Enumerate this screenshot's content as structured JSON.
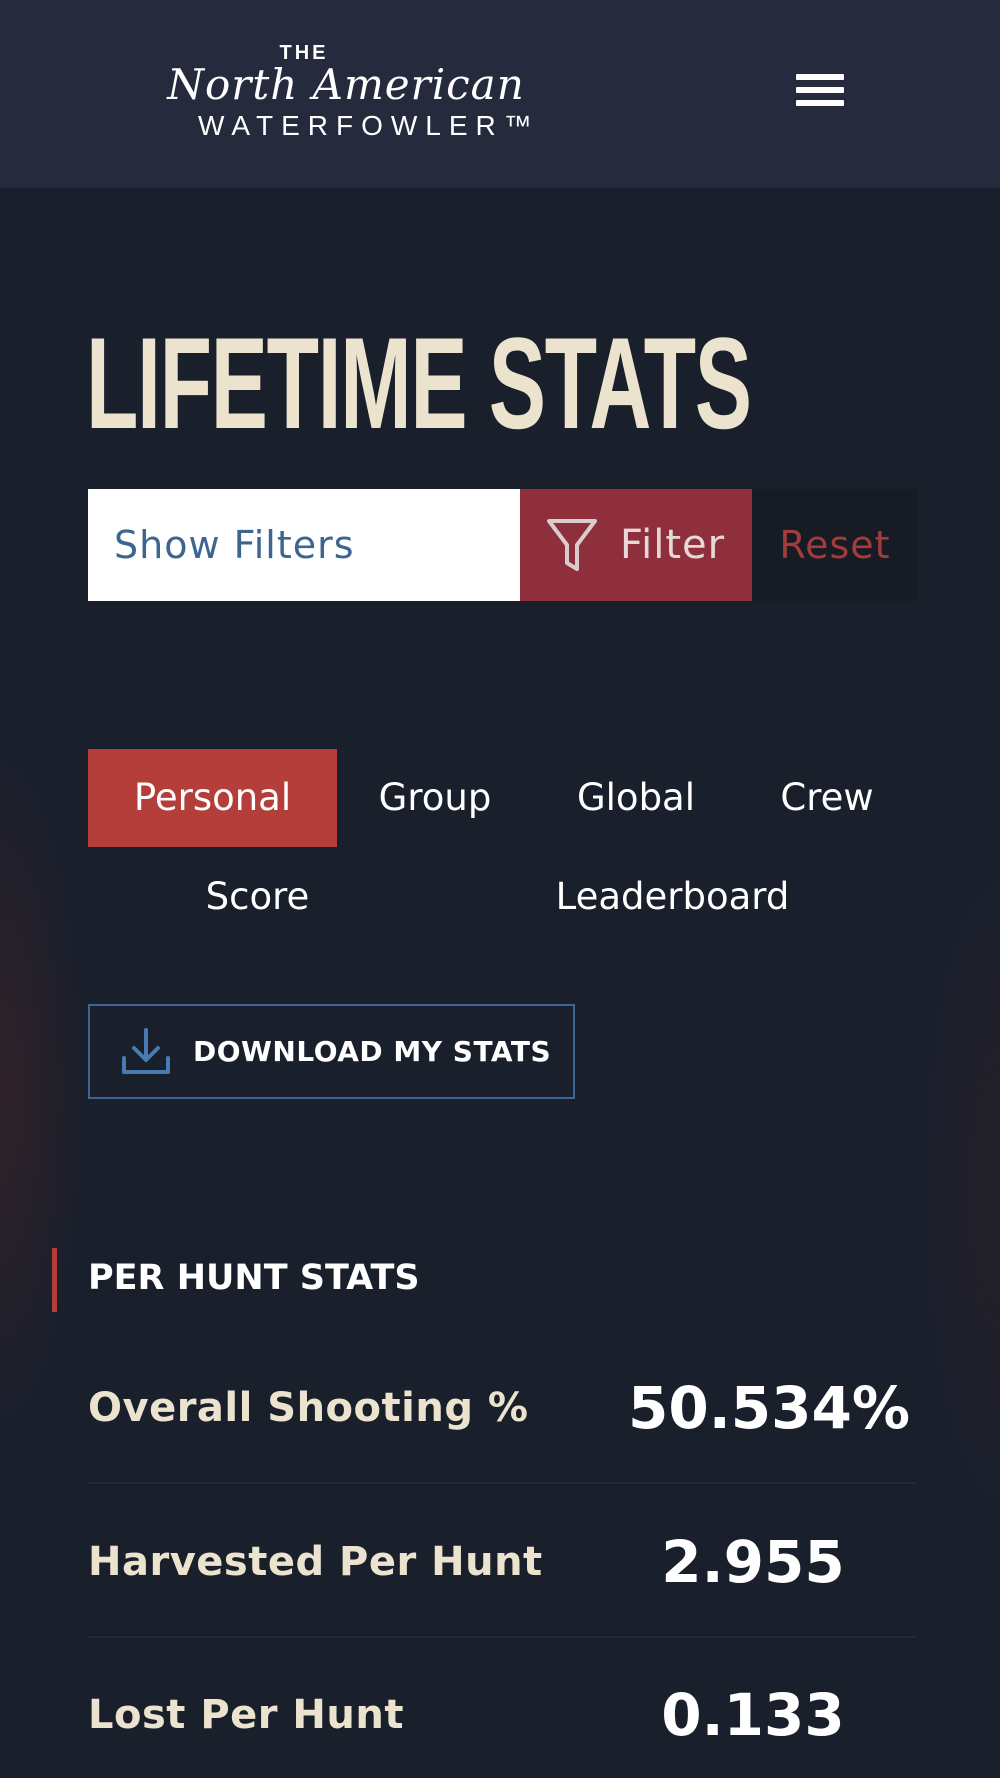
{
  "header": {
    "logo": {
      "the": "THE",
      "main": "North American",
      "sub": "WATERFOWLER™"
    },
    "menu_icon": "hamburger-menu-icon"
  },
  "page": {
    "title": "LIFETIME STATS"
  },
  "filters": {
    "show_filters_label": "Show Filters",
    "filter_label": "Filter",
    "filter_icon": "funnel-icon",
    "reset_label": "Reset"
  },
  "tabs": [
    {
      "label": "Personal",
      "active": true
    },
    {
      "label": "Group",
      "active": false
    },
    {
      "label": "Global",
      "active": false
    },
    {
      "label": "Crew",
      "active": false
    },
    {
      "label": "Score",
      "active": false
    },
    {
      "label": "Leaderboard",
      "active": false
    }
  ],
  "download": {
    "label": "DOWNLOAD MY STATS",
    "icon": "download-icon"
  },
  "per_hunt": {
    "title": "PER HUNT STATS",
    "rows": [
      {
        "label": "Overall Shooting %",
        "value": "50.534%"
      },
      {
        "label": "Harvested Per Hunt",
        "value": "2.955"
      },
      {
        "label": "Lost Per Hunt",
        "value": "0.133"
      }
    ]
  },
  "colors": {
    "header_bg": "#252b3d",
    "page_bg": "#1a1f2c",
    "accent_red": "#b33e3a",
    "filter_red": "#8e2f3b",
    "title_cream": "#ece3cf",
    "link_blue": "#3e6592"
  }
}
